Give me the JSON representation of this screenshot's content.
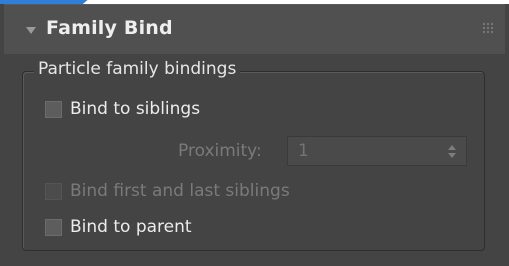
{
  "rollout": {
    "title": "Family Bind",
    "group_title": "Particle family bindings",
    "bind_to_siblings": {
      "label": "Bind to siblings",
      "checked": false
    },
    "proximity": {
      "label": "Proximity:",
      "value": "1"
    },
    "bind_first_last": {
      "label": "Bind first and last siblings",
      "checked": false,
      "enabled": false
    },
    "bind_to_parent": {
      "label": "Bind to parent",
      "checked": false
    }
  },
  "icons": {
    "collapse": "triangle-down-icon",
    "grip": "grip-dots-icon",
    "spinner": "spinner-arrows-icon"
  },
  "colors": {
    "panel_bg": "#444444",
    "header_bg": "#505050",
    "text": "#ececec",
    "disabled_text": "#7a7a7a"
  }
}
